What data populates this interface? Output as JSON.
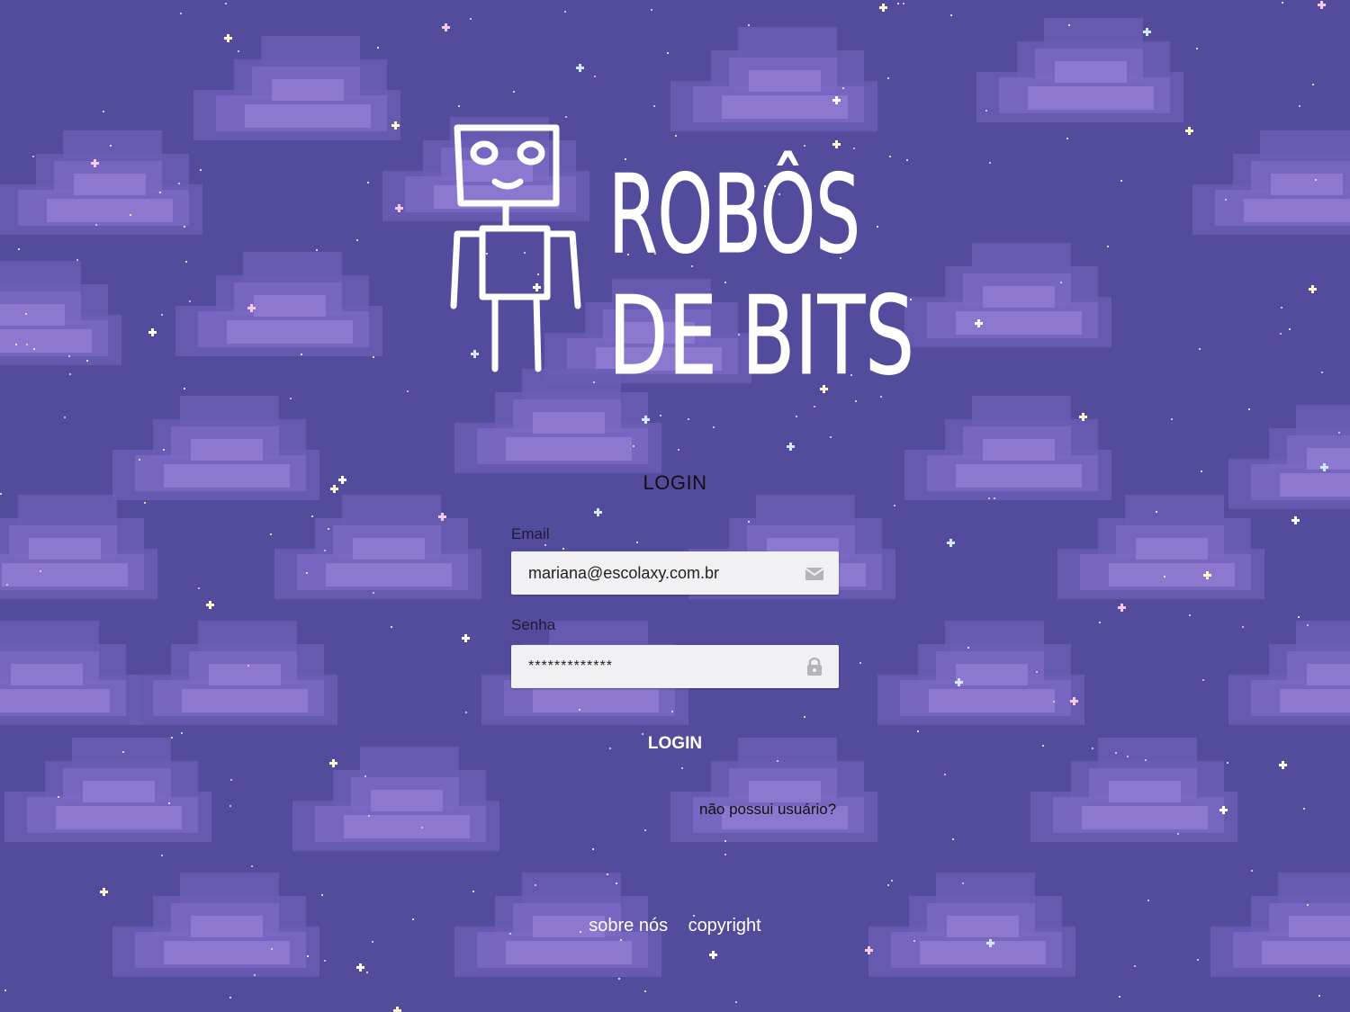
{
  "brand": {
    "logo_text_line1": "ROBÔS",
    "logo_text_line2": "DE BITS"
  },
  "form": {
    "title": "LOGIN",
    "email": {
      "label": "Email",
      "value": "mariana@escolaxy.com.br",
      "icon": "envelope-icon"
    },
    "password": {
      "label": "Senha",
      "value": "*************",
      "icon": "lock-icon"
    },
    "submit_label": "LOGIN",
    "register_link": "não possui usuário?"
  },
  "footer": {
    "links": [
      "sobre nós",
      "copyright"
    ]
  },
  "colors": {
    "background": "#534c9c",
    "cloud": "#8f7cd1",
    "field_bg": "#f1f0f3",
    "text_light": "#ffffff"
  }
}
